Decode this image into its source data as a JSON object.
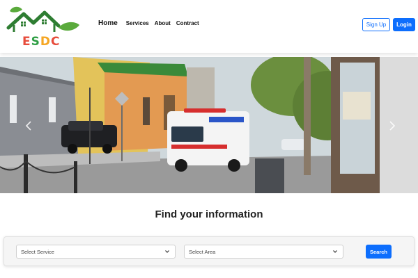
{
  "brand": {
    "letters": [
      "E",
      "S",
      "D",
      "C"
    ],
    "colors": [
      "#e74c3c",
      "#2e9e44",
      "#f5a623",
      "#e74c3c"
    ]
  },
  "nav": {
    "links": [
      "Home",
      "Services",
      "About",
      "Contract"
    ],
    "active": "Home"
  },
  "auth": {
    "signup_label": "Sign Up",
    "login_label": "Login"
  },
  "hero": {
    "image": "street-with-ambulance",
    "prev_icon": "chevron-left-icon",
    "next_icon": "chevron-right-icon"
  },
  "section": {
    "title": "Find your information"
  },
  "search": {
    "service_placeholder": "Select Service",
    "area_placeholder": "Select Area",
    "button_label": "Search"
  },
  "colors": {
    "primary": "#0d6efd",
    "logo_green": "#2e9e44"
  }
}
